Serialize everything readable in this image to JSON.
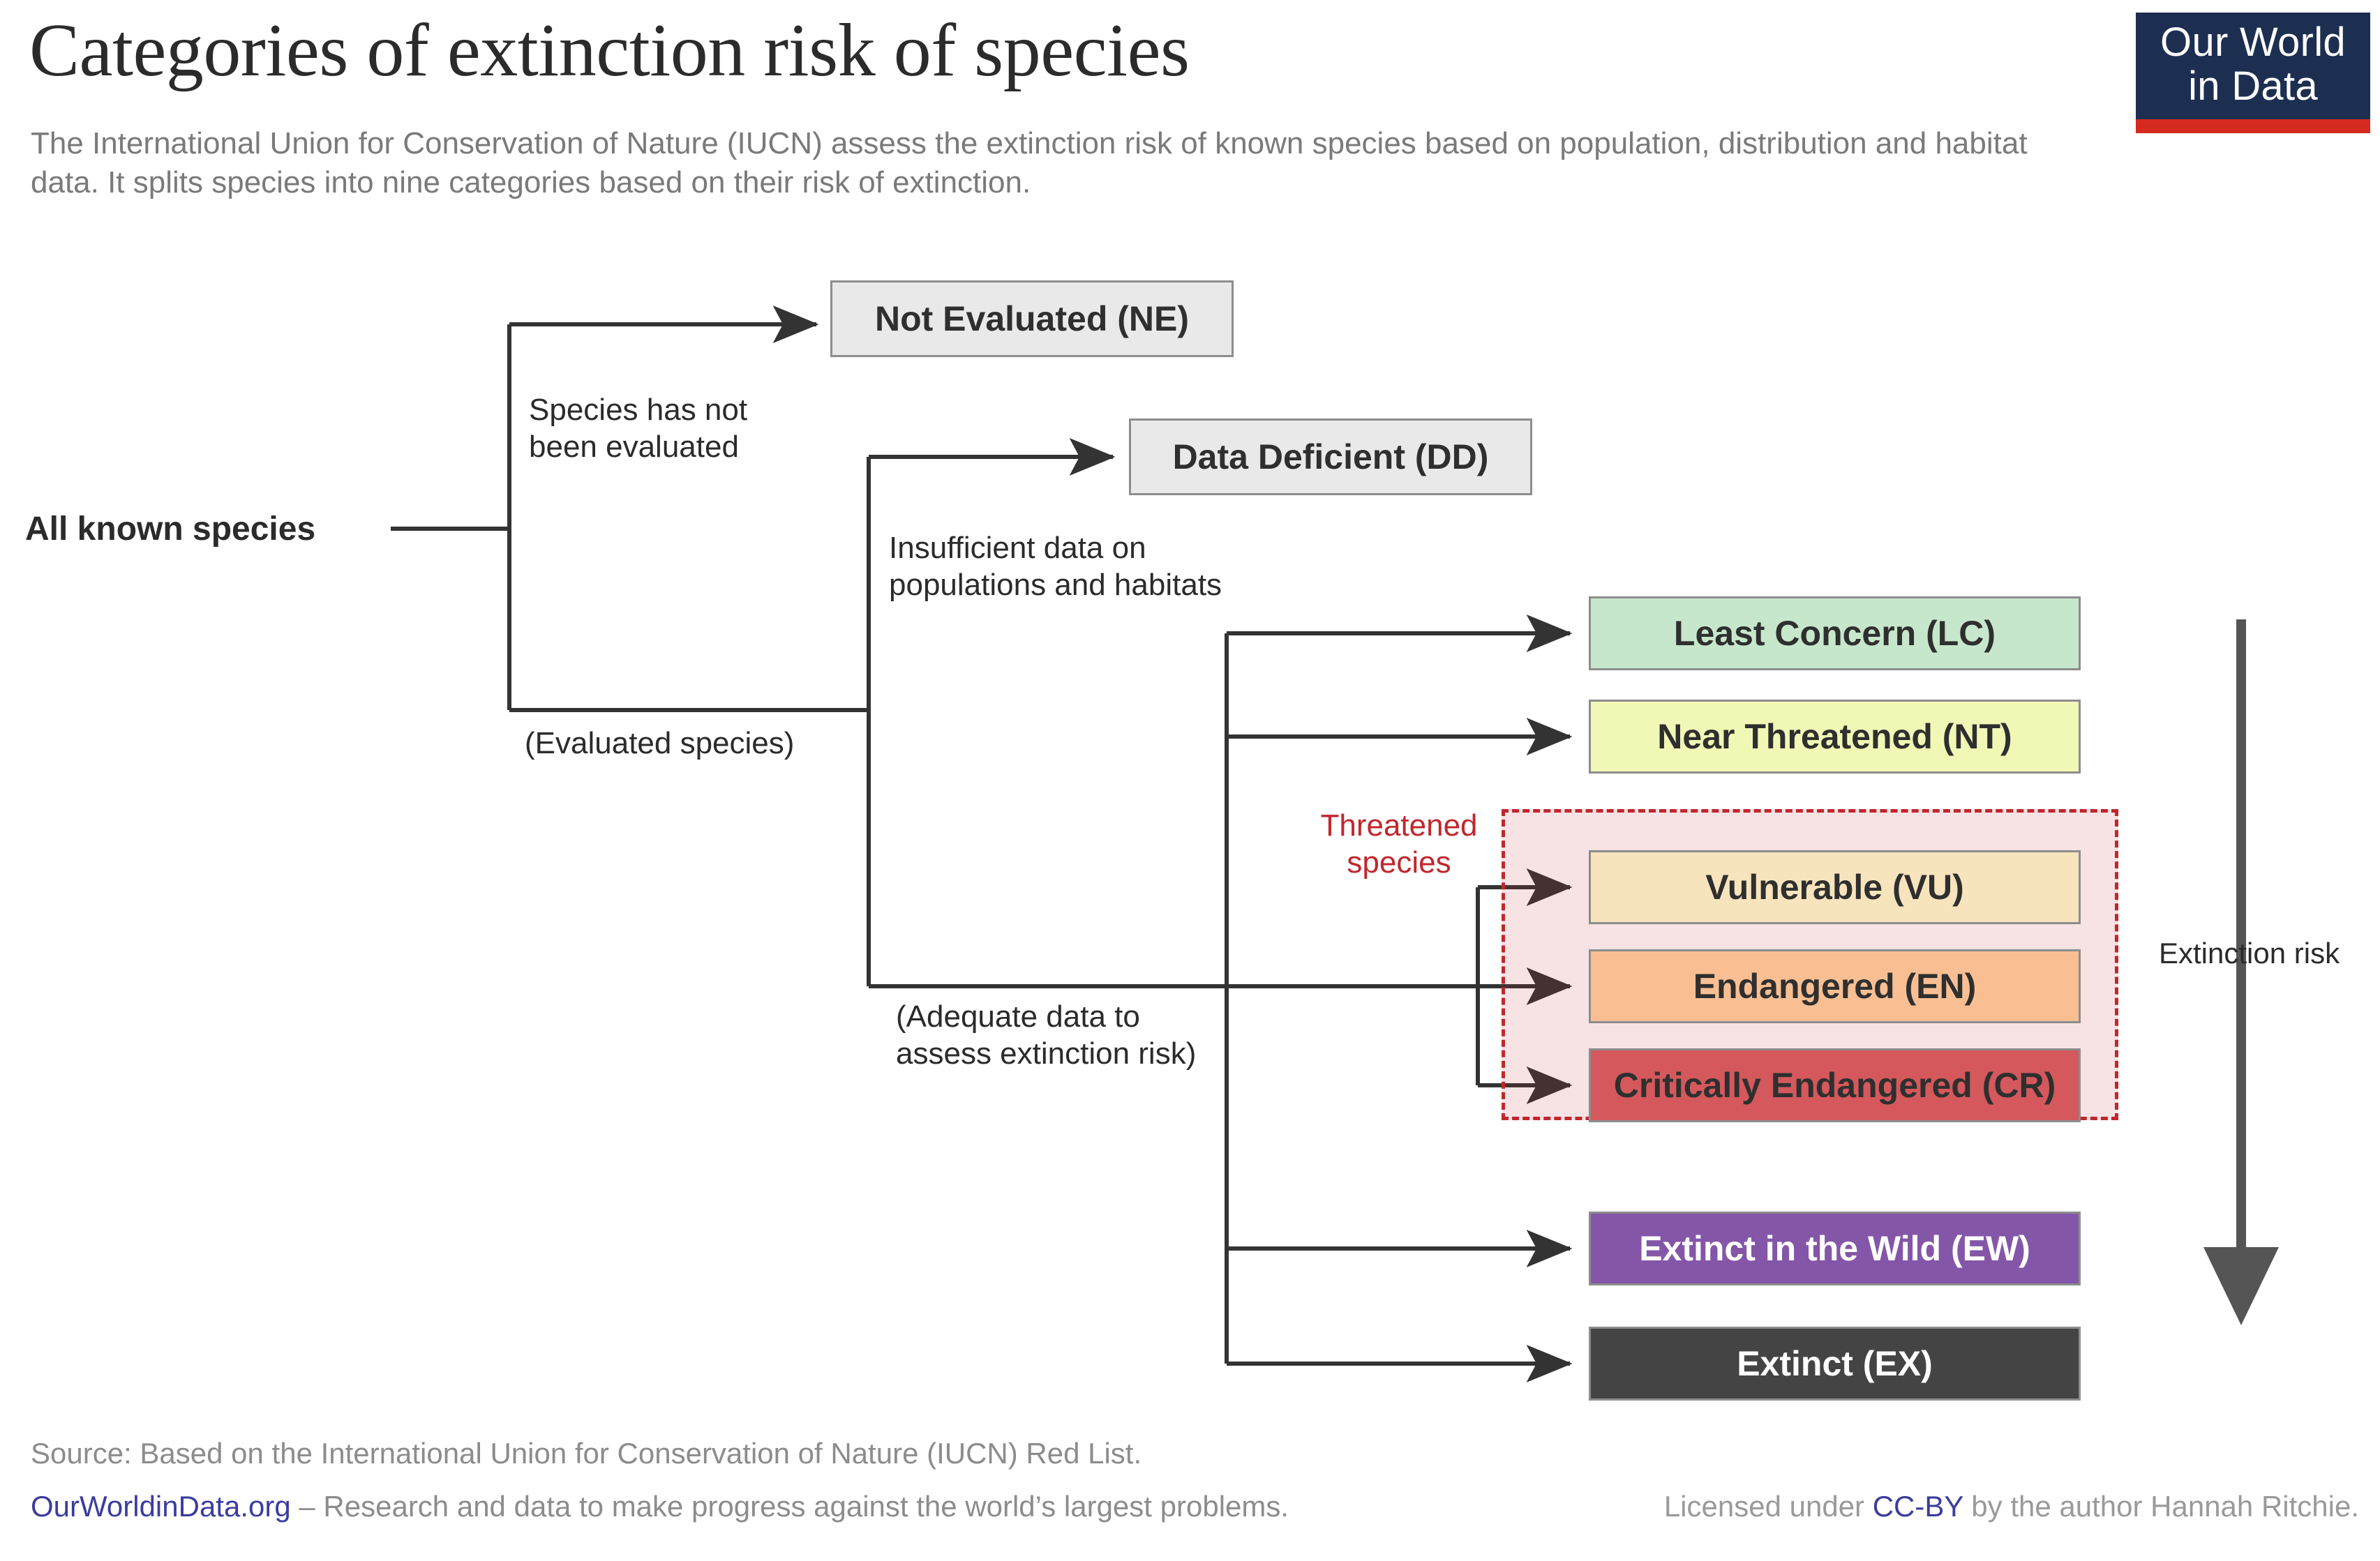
{
  "header": {
    "title": "Categories of extinction risk of species",
    "subtitle": "The International Union for Conservation of Nature (IUCN) assess the extinction risk of known species based on population, distribution and habitat data. It splits species into nine categories based on their risk of extinction."
  },
  "logo": {
    "line1": "Our World",
    "line2": "in Data",
    "bg_color": "#1d2f51",
    "bar_color": "#d42b1e"
  },
  "diagram": {
    "root_label": "All known species",
    "branch_labels": {
      "not_evaluated": "Species has not\nbeen evaluated",
      "evaluated": "(Evaluated species)",
      "insufficient_data": "Insufficient data on\npopulations and habitats",
      "adequate_data": "(Adequate data to\nassess extinction risk)"
    },
    "threatened_group_label": "Threatened\nspecies",
    "threatened_group_color": "#c0272d",
    "risk_axis_label": "Extinction risk",
    "nodes": [
      {
        "id": "NE",
        "label": "Not Evaluated (NE)",
        "fill": "#e9e9e9",
        "text": "#2f2f2f"
      },
      {
        "id": "DD",
        "label": "Data Deficient (DD)",
        "fill": "#e9e9e9",
        "text": "#2f2f2f"
      },
      {
        "id": "LC",
        "label": "Least Concern (LC)",
        "fill": "#c6e7cb",
        "text": "#2f2f2f"
      },
      {
        "id": "NT",
        "label": "Near Threatened (NT)",
        "fill": "#f1f8b5",
        "text": "#2f2f2f"
      },
      {
        "id": "VU",
        "label": "Vulnerable (VU)",
        "fill": "#f7e4bd",
        "text": "#2f2f2f"
      },
      {
        "id": "EN",
        "label": "Endangered (EN)",
        "fill": "#f9bf93",
        "text": "#2f2f2f"
      },
      {
        "id": "CR",
        "label": "Critically Endangered (CR)",
        "fill": "#d4585c",
        "text": "#2f2f2f"
      },
      {
        "id": "EW",
        "label": "Extinct in the Wild (EW)",
        "fill": "#8456a8",
        "text": "#ffffff"
      },
      {
        "id": "EX",
        "label": "Extinct (EX)",
        "fill": "#444444",
        "text": "#ffffff"
      }
    ]
  },
  "footer": {
    "source": "Source: Based on the International Union for Conservation of Nature (IUCN) Red List.",
    "owid_link": "OurWorldinData.org",
    "owid_tagline": " – Research and data to make progress against the world’s largest problems.",
    "license_prefix": "Licensed under ",
    "license_link": "CC-BY",
    "license_suffix": " by the author Hannah Ritchie."
  },
  "chart_data": {
    "type": "diagram",
    "title": "Categories of extinction risk of species",
    "categories": [
      "Not Evaluated (NE)",
      "Data Deficient (DD)",
      "Least Concern (LC)",
      "Near Threatened (NT)",
      "Vulnerable (VU)",
      "Endangered (EN)",
      "Critically Endangered (CR)",
      "Extinct in the Wild (EW)",
      "Extinct (EX)"
    ],
    "groups": {
      "threatened": [
        "Vulnerable (VU)",
        "Endangered (EN)",
        "Critically Endangered (CR)"
      ]
    },
    "axis_annotation": "Extinction risk"
  }
}
